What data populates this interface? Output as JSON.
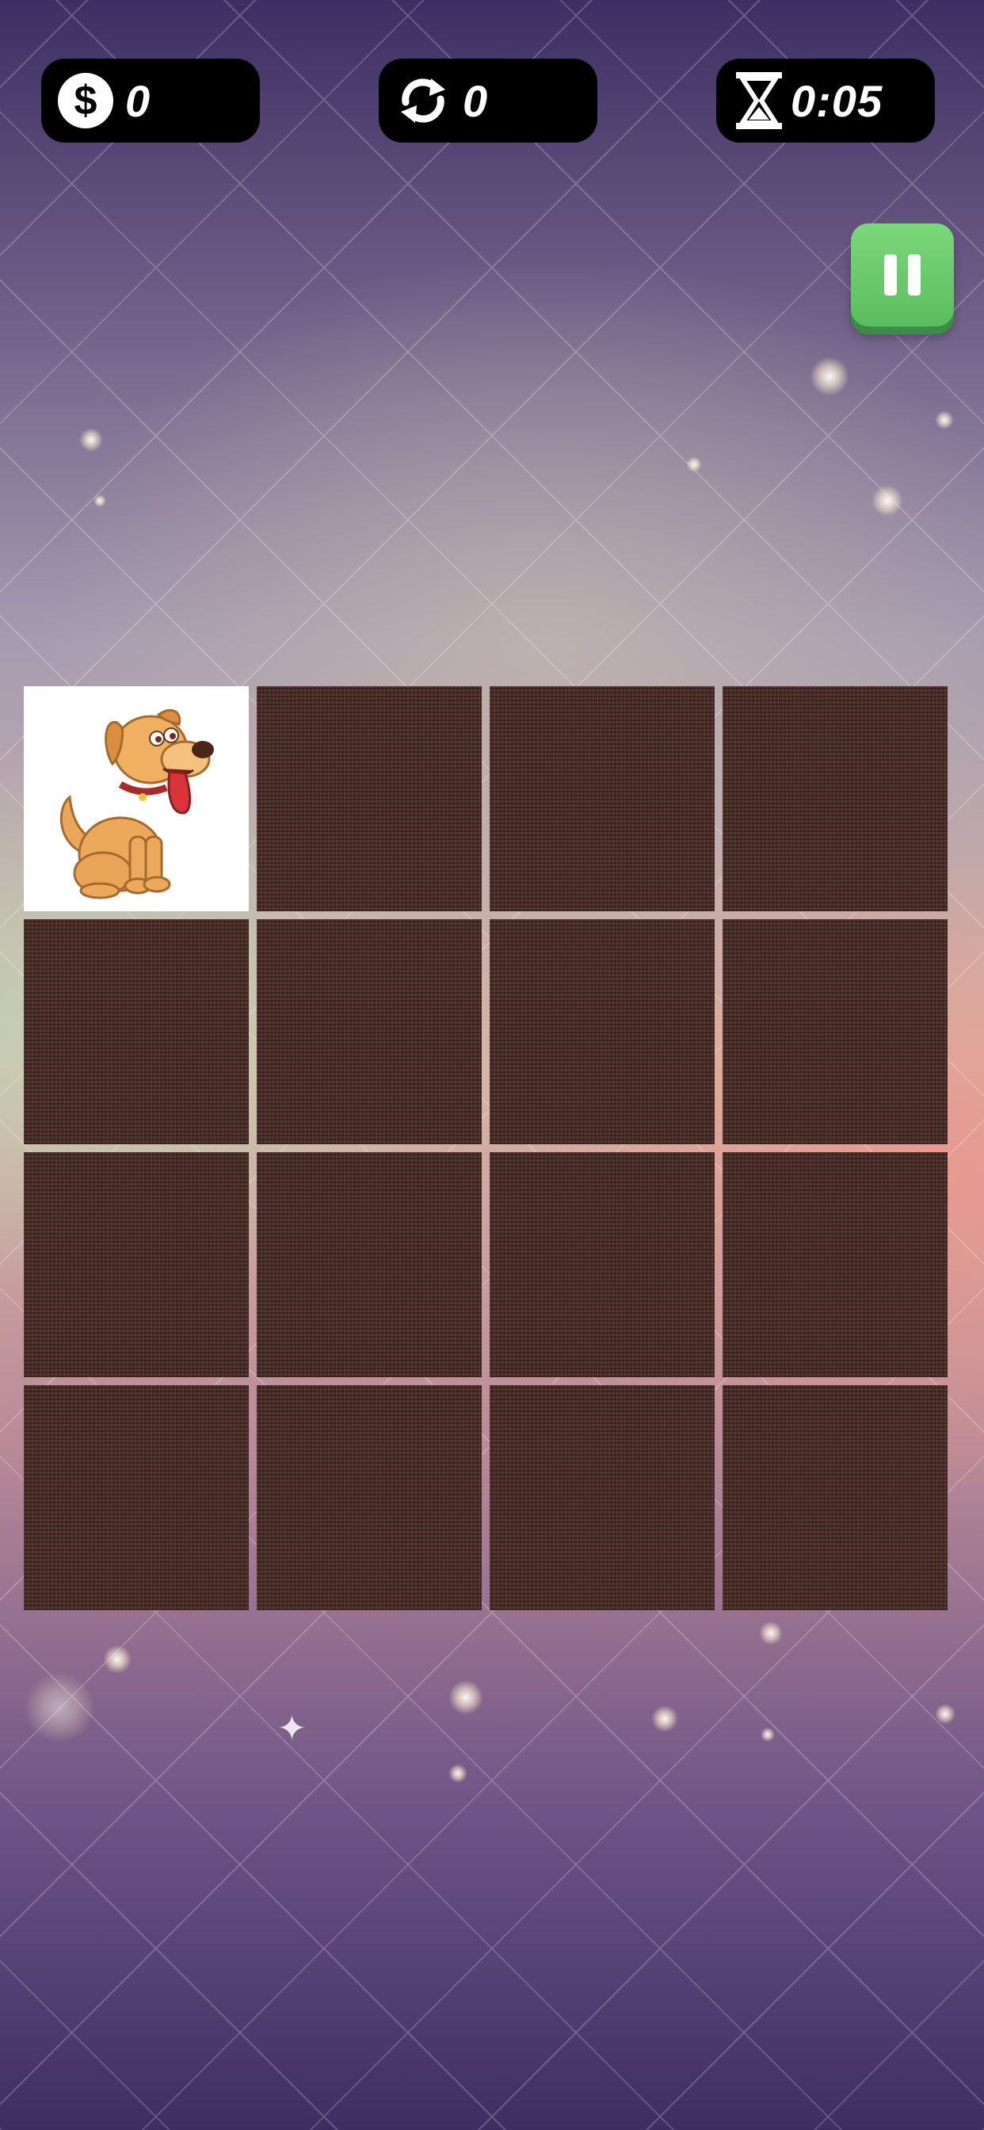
{
  "hud": {
    "coins": {
      "icon": "dollar-coin-icon",
      "value": "0"
    },
    "moves": {
      "icon": "refresh-arrows-icon",
      "value": "0"
    },
    "timer": {
      "icon": "hourglass-icon",
      "value": "0:05"
    }
  },
  "pause_button": {
    "icon": "pause-icon",
    "color": "#5bbd5f"
  },
  "board": {
    "rows": 4,
    "cols": 4,
    "revealed_tile": {
      "row": 1,
      "col": 1,
      "image": "cartoon-dog-image"
    },
    "card_back_color": "#4a2e2a"
  }
}
